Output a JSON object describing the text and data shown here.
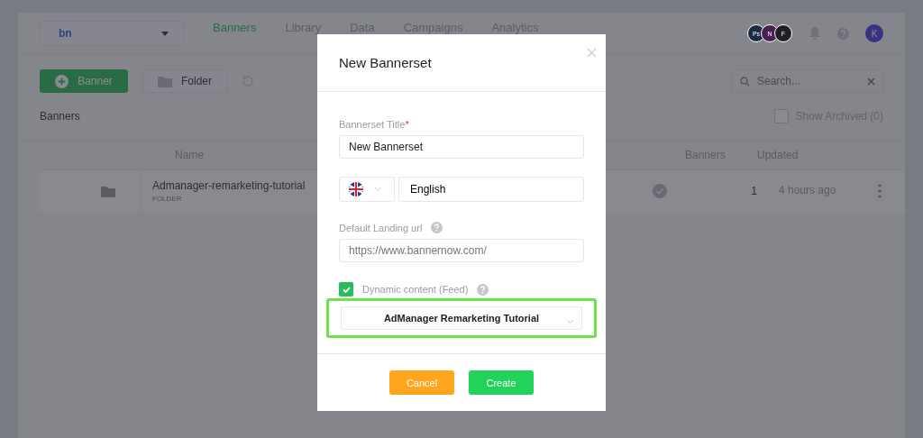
{
  "header": {
    "workspace": {
      "logo": "bn"
    },
    "nav": [
      {
        "label": "Banners",
        "selected": true
      },
      {
        "label": "Library",
        "selected": false
      },
      {
        "label": "Data",
        "selected": false
      },
      {
        "label": "Campaigns",
        "selected": false
      },
      {
        "label": "Analytics",
        "selected": false
      }
    ],
    "apps": [
      {
        "label": "Ps",
        "color": "#1a2a45"
      },
      {
        "label": "N",
        "color": "#4a1f55"
      },
      {
        "label": "F",
        "color": "#1f2024"
      }
    ],
    "user": {
      "initial": "K"
    }
  },
  "toolbar": {
    "buttons": [
      {
        "label": "Banner",
        "kind": "primary"
      },
      {
        "label": "Folder",
        "kind": "secondary"
      }
    ],
    "search": {
      "placeholder": "Search..."
    }
  },
  "section": {
    "title": "Banners",
    "show_archived": {
      "label": "Show Archived (0)",
      "checked": false
    }
  },
  "table": {
    "columns": [
      "Name",
      "Banners",
      "Updated"
    ],
    "rows": [
      {
        "name": "Admanager-remarketing-tutorial",
        "type": "FOLDER",
        "published": true,
        "banners": "1",
        "updated": "4 hours ago"
      }
    ]
  },
  "dialog": {
    "title": "New Bannerset",
    "title_label": "Bannerset Title",
    "required_mark": "*",
    "title_value": "New Bannerset",
    "language": "English",
    "landing_label": "Default Landing url",
    "landing_placeholder": "https://www.bannernow.com/",
    "dynamic": {
      "label": "Dynamic content (Feed)",
      "checked": true
    },
    "feed": "AdManager Remarketing Tutorial",
    "feed_highlighted": true,
    "buttons": [
      {
        "label": "Cancel",
        "kind": "cancel"
      },
      {
        "label": "Create",
        "kind": "create"
      }
    ]
  }
}
